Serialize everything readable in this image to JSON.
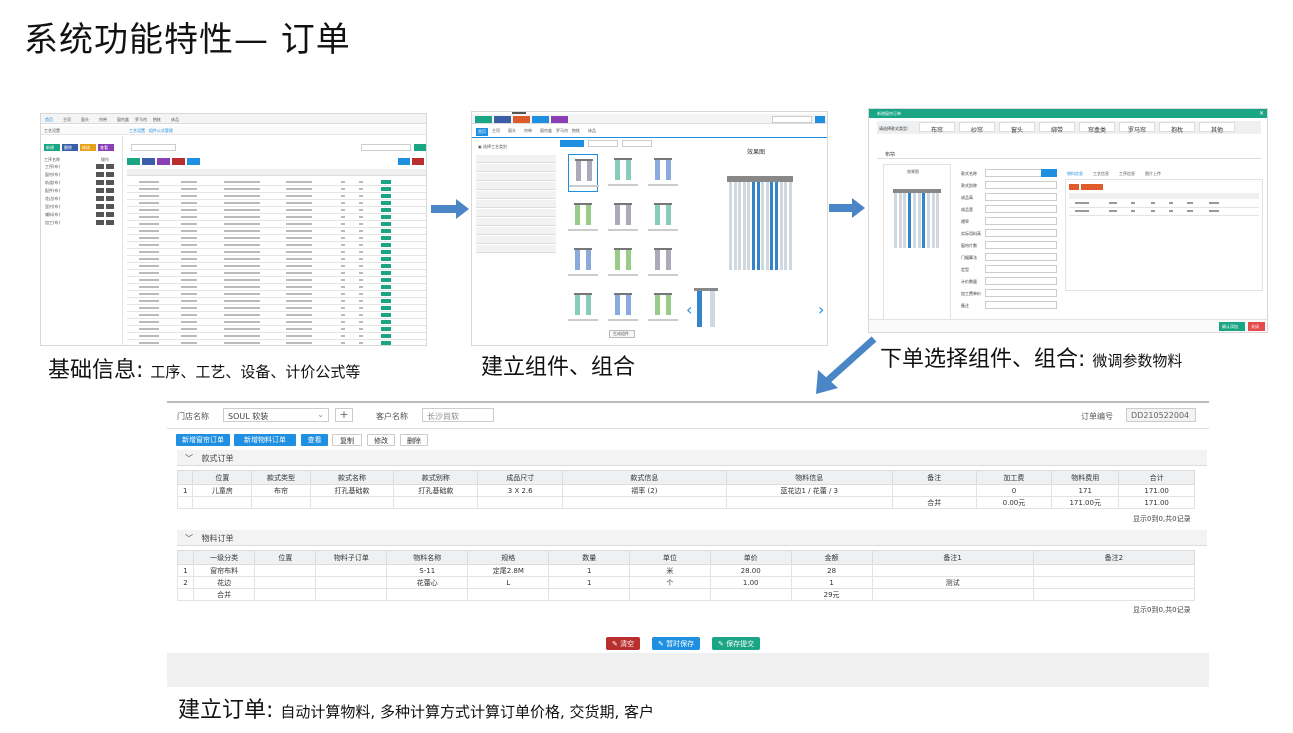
{
  "title": "系统功能特性— 订单",
  "captions": {
    "basic": "基础信息:",
    "basic_sub": "工序、工艺、设备、计价公式等",
    "component": "建立组件、组合",
    "select": "下单选择组件、组合:",
    "select_sub": "微调参数物料",
    "order": "建立订单:",
    "order_sub": "自动计算物料, 多种计算方式计算订单价格, 交货期, 客户"
  },
  "colors": {
    "accent": "#1e8fe1",
    "arrow": "#4a86c5",
    "teal": "#1aa584",
    "red": "#b92f2f"
  },
  "order": {
    "store_label": "门店名称",
    "store_value": "SOUL 软装",
    "customer_label": "客户名称",
    "customer_value": "长沙尚软",
    "order_no_label": "订单编号",
    "order_no_value": "DD210522004",
    "buttons": [
      "新增窗帘订单",
      "新增物料订单",
      "查看",
      "复制",
      "修改",
      "删除"
    ],
    "style_section": "款式订单",
    "style_headers": [
      "位置",
      "款式类型",
      "款式名称",
      "款式别称",
      "成品尺寸",
      "款式信息",
      "物料信息",
      "备注",
      "加工费",
      "物料费用",
      "合计"
    ],
    "style_rows": [
      [
        "1",
        "儿童房",
        "布帘",
        "打孔基础款",
        "打孔基础款",
        "3 X 2.6",
        "褶率 (2)",
        "蓝花边1 / 花蕾 / 3",
        "",
        "0",
        "171",
        "171.00"
      ]
    ],
    "style_total": [
      "合并",
      "0.00元",
      "171.00元",
      "171.00"
    ],
    "style_footer": "显示0到0,共0记录",
    "material_section": "物料订单",
    "material_headers": [
      "一级分类",
      "位置",
      "物料子订单",
      "物料名称",
      "规格",
      "数量",
      "单位",
      "单价",
      "金额",
      "备注1",
      "备注2"
    ],
    "material_rows": [
      [
        "1",
        "窗帘布料",
        "",
        "",
        "S-11",
        "定尾2.8M",
        "1",
        "米",
        "28.00",
        "28",
        "",
        ""
      ],
      [
        "2",
        "花边",
        "",
        "",
        "花蕾心",
        "L",
        "1",
        "个",
        "1.00",
        "1",
        "测试",
        ""
      ]
    ],
    "material_total": [
      "合并",
      "29元"
    ],
    "material_footer": "显示0到0,共0记录",
    "bottom_buttons": [
      "清空",
      "暂时保存",
      "保存提交"
    ]
  },
  "shot1": {
    "tabs": [
      "首页",
      "主项",
      "窗头",
      "帘带",
      "窗帘盒",
      "罗马帘",
      "抱枕",
      "床品"
    ],
    "buttons": [
      "新增",
      "删除",
      "修改",
      "查看"
    ],
    "tree": [
      "工序(布)",
      "窗帘(布)",
      "轨道(布)",
      "配件(布)",
      "花边(布)",
      "里衬(布)",
      "辅料(布)",
      "加工(布)"
    ]
  },
  "shot2": {
    "tabs": [
      "首页",
      "主项",
      "窗头",
      "帘带",
      "窗帘盒",
      "罗马帘",
      "抱枕",
      "床品"
    ],
    "panel_title": "效果图",
    "save_button": "生成组件"
  },
  "shot3": {
    "dialog_title": "新增窗帘订单",
    "type_tabs": [
      "布帘",
      "纱帘",
      "窗头",
      "绑带",
      "帘盒类",
      "罗马帘",
      "抱枕",
      "其他"
    ],
    "form_tab": "布帘",
    "preview_label": "效果图",
    "fields": [
      "款式名称",
      "款式别称",
      "成品高",
      "成品宽",
      "褶率",
      "实际用料高",
      "窗帘片数",
      "门幅算法",
      "定型",
      "计价数量",
      "加工费单价",
      "备注"
    ],
    "side_tabs": [
      "物料信息",
      "工艺信息",
      "工序信息",
      "图片上传"
    ],
    "confirm": "确认添加",
    "close": "关闭"
  }
}
